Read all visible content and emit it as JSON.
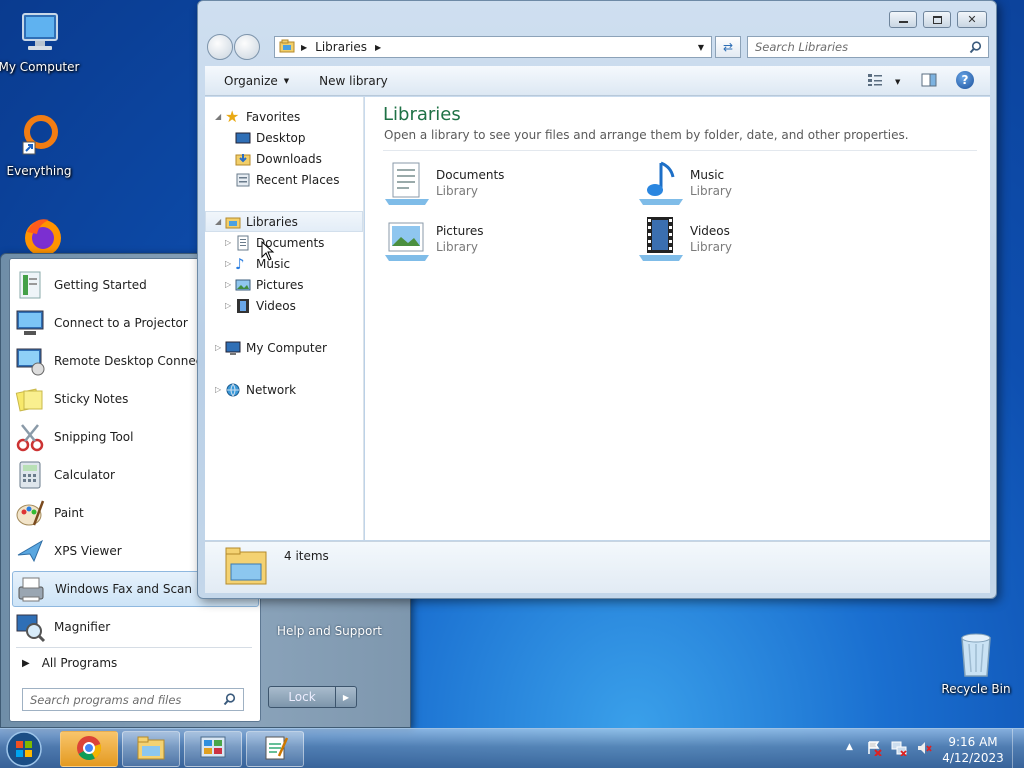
{
  "desktop": {
    "icons": [
      {
        "label": "My Computer"
      },
      {
        "label": "Everything"
      },
      {
        "label": "Recycle Bin"
      }
    ]
  },
  "start_menu": {
    "items": [
      {
        "label": "Getting Started",
        "icon": "getting-started-icon"
      },
      {
        "label": "Connect to a Projector",
        "icon": "projector-icon"
      },
      {
        "label": "Remote Desktop Connection",
        "icon": "remote-desktop-icon"
      },
      {
        "label": "Sticky Notes",
        "icon": "sticky-notes-icon"
      },
      {
        "label": "Snipping Tool",
        "icon": "snipping-tool-icon"
      },
      {
        "label": "Calculator",
        "icon": "calculator-icon"
      },
      {
        "label": "Paint",
        "icon": "paint-icon"
      },
      {
        "label": "XPS Viewer",
        "icon": "xps-viewer-icon"
      },
      {
        "label": "Windows Fax and Scan",
        "icon": "fax-scan-icon",
        "highlighted": true
      },
      {
        "label": "Magnifier",
        "icon": "magnifier-icon"
      }
    ],
    "all_programs": "All Programs",
    "search_placeholder": "Search programs and files",
    "help": "Help and Support",
    "lock": "Lock"
  },
  "explorer": {
    "address": {
      "segments": [
        "Libraries"
      ]
    },
    "search_placeholder": "Search Libraries",
    "toolbar": {
      "organize": "Organize",
      "new_library": "New library"
    },
    "nav": {
      "favorites": "Favorites",
      "favorites_items": [
        "Desktop",
        "Downloads",
        "Recent Places"
      ],
      "libraries": "Libraries",
      "libraries_items": [
        "Documents",
        "Music",
        "Pictures",
        "Videos"
      ],
      "my_computer": "My Computer",
      "network": "Network"
    },
    "content": {
      "title": "Libraries",
      "subtitle": "Open a library to see your files and arrange them by folder, date, and other properties.",
      "libraries": [
        {
          "name": "Documents",
          "type": "Library"
        },
        {
          "name": "Music",
          "type": "Library"
        },
        {
          "name": "Pictures",
          "type": "Library"
        },
        {
          "name": "Videos",
          "type": "Library"
        }
      ]
    },
    "details": {
      "count": "4 items"
    }
  },
  "taskbar": {
    "time": "9:16 AM",
    "date": "4/12/2023"
  },
  "colors": {
    "accent": "#1e7145",
    "title_green": "#1e7145",
    "selection": "#cde4f7"
  }
}
